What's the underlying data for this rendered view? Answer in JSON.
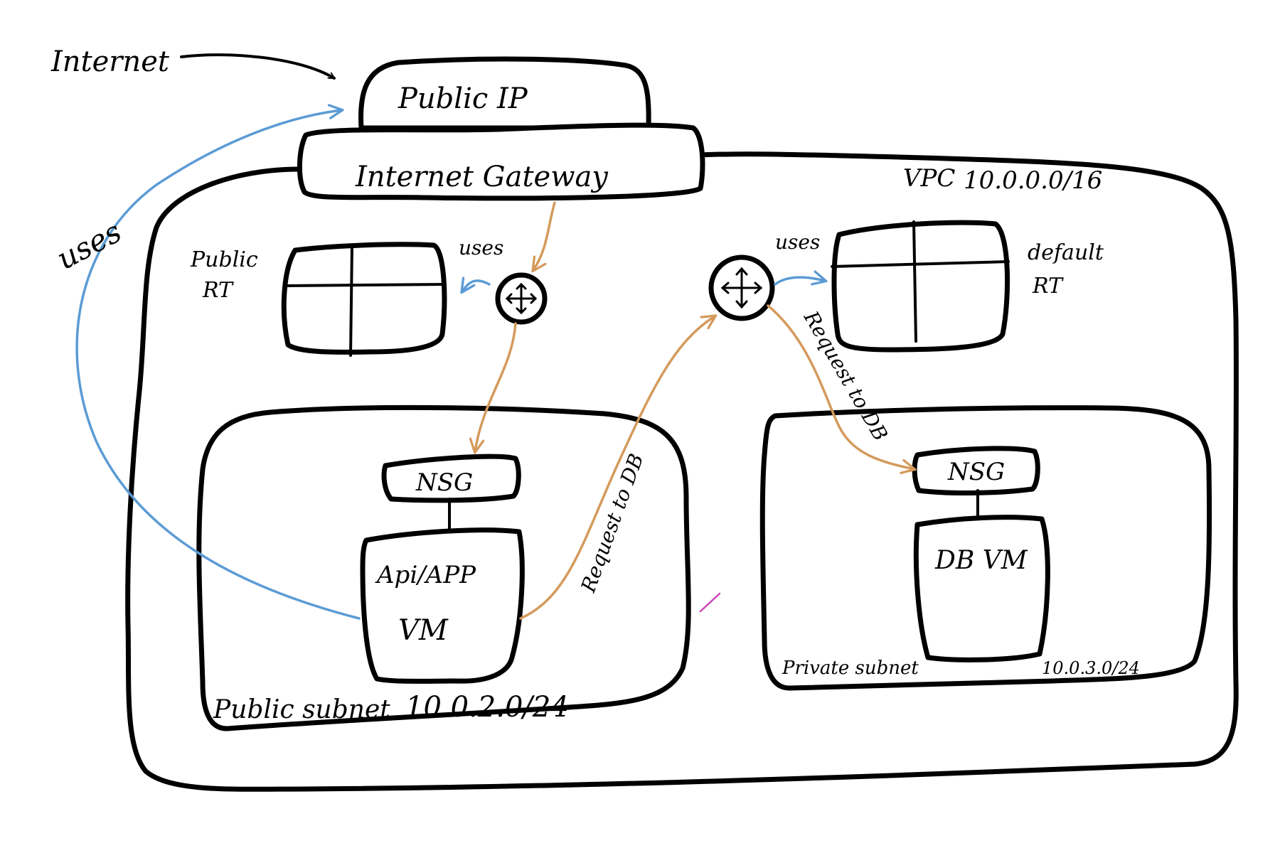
{
  "labels": {
    "internet": "Internet",
    "public_ip": "Public IP",
    "internet_gateway": "Internet Gateway",
    "vpc": "VPC",
    "vpc_cidr": "10.0.0.0/16",
    "public_rt_line1": "Public",
    "public_rt_line2": "RT",
    "default_rt_line1": "default",
    "default_rt_line2": "RT",
    "uses_left": "uses",
    "uses_public_rt": "uses",
    "uses_default_rt": "uses",
    "nsg_public": "NSG",
    "nsg_private": "NSG",
    "app_vm_line1": "Api/APP",
    "app_vm_line2": "VM",
    "db_vm": "DB VM",
    "public_subnet": "Public subnet",
    "public_subnet_cidr": "10.0.2.0/24",
    "private_subnet": "Private subnet",
    "private_subnet_cidr": "10.0.3.0/24",
    "request_to_db_1": "Request to DB",
    "request_to_db_2": "Request to DB"
  },
  "colors": {
    "ink": "#000000",
    "flow_orange": "#d49a5c",
    "flow_blue": "#5b9bd5",
    "cidr_magenta": "#cc44bb",
    "vpc_cidr_navy": "#2a2470"
  }
}
